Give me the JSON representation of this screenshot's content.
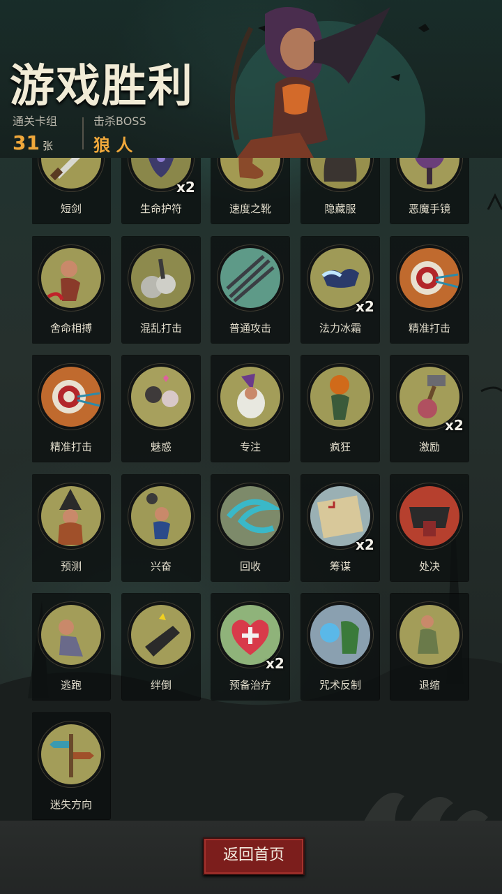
{
  "header": {
    "title": "游戏胜利",
    "deck_label": "通关卡组",
    "deck_count": "31",
    "deck_unit": "张",
    "boss_label": "击杀BOSS",
    "boss_name": "狼 人"
  },
  "cards": [
    {
      "name": "短剑",
      "count": "",
      "icon": "sword-icon",
      "tint": "#a19a54"
    },
    {
      "name": "生命护符",
      "count": "x2",
      "icon": "amulet-icon",
      "tint": "#8a874a"
    },
    {
      "name": "速度之靴",
      "count": "",
      "icon": "boot-icon",
      "tint": "#a39a52"
    },
    {
      "name": "隐藏服",
      "count": "",
      "icon": "cloak-icon",
      "tint": "#97904d"
    },
    {
      "name": "恶魔手镜",
      "count": "",
      "icon": "mirror-icon",
      "tint": "#a29b58"
    },
    {
      "name": "舍命相搏",
      "count": "",
      "icon": "fighter-icon",
      "tint": "#9f9a57"
    },
    {
      "name": "混乱打击",
      "count": "",
      "icon": "smoke-icon",
      "tint": "#8d8a4d"
    },
    {
      "name": "普通攻击",
      "count": "",
      "icon": "arrows-icon",
      "tint": "#5e9a88"
    },
    {
      "name": "法力冰霜",
      "count": "x2",
      "icon": "frost-icon",
      "tint": "#9f9a57"
    },
    {
      "name": "精准打击",
      "count": "",
      "icon": "target-icon",
      "tint": "#c06a2e"
    },
    {
      "name": "精准打击",
      "count": "",
      "icon": "target-icon",
      "tint": "#c06a2e"
    },
    {
      "name": "魅惑",
      "count": "",
      "icon": "charm-icon",
      "tint": "#a7a05d"
    },
    {
      "name": "专注",
      "count": "",
      "icon": "wizard-icon",
      "tint": "#a39d59"
    },
    {
      "name": "疯狂",
      "count": "",
      "icon": "pumpkin-icon",
      "tint": "#9f9a57"
    },
    {
      "name": "激励",
      "count": "x2",
      "icon": "hammer-icon",
      "tint": "#a39d59"
    },
    {
      "name": "预测",
      "count": "",
      "icon": "witch-icon",
      "tint": "#a39d59"
    },
    {
      "name": "兴奋",
      "count": "",
      "icon": "dwarf-icon",
      "tint": "#9f9a57"
    },
    {
      "name": "回收",
      "count": "",
      "icon": "swirl-icon",
      "tint": "#7d8a6a"
    },
    {
      "name": "筹谋",
      "count": "x2",
      "icon": "map-icon",
      "tint": "#9ab0b4"
    },
    {
      "name": "处决",
      "count": "",
      "icon": "execute-icon",
      "tint": "#b6402e"
    },
    {
      "name": "逃跑",
      "count": "",
      "icon": "run-icon",
      "tint": "#a39d59"
    },
    {
      "name": "绊倒",
      "count": "",
      "icon": "trip-icon",
      "tint": "#a39d59"
    },
    {
      "name": "预备治疗",
      "count": "x2",
      "icon": "heal-icon",
      "tint": "#8fb37a"
    },
    {
      "name": "咒术反制",
      "count": "",
      "icon": "counter-icon",
      "tint": "#8aa0b0"
    },
    {
      "name": "退缩",
      "count": "",
      "icon": "retreat-icon",
      "tint": "#a39d59"
    },
    {
      "name": "迷失方向",
      "count": "",
      "icon": "signpost-icon",
      "tint": "#a39d59"
    }
  ],
  "footer": {
    "return_label": "返回首页"
  },
  "colors": {
    "accent": "#f0a83b",
    "button": "#7c1e1c"
  }
}
